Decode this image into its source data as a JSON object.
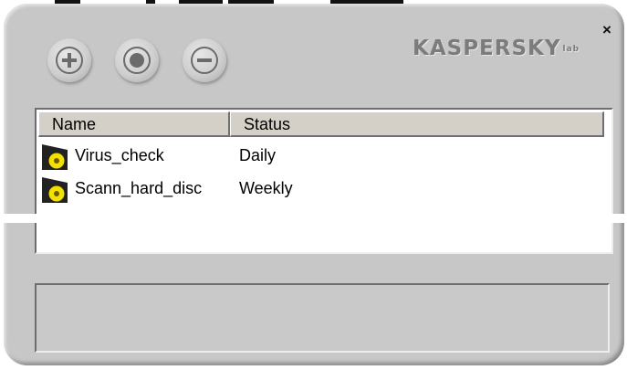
{
  "window": {
    "brand": "KASPERSKY",
    "brand_suffix": "lab",
    "close_label": "×"
  },
  "toolbar": {
    "add_icon": "plus-circle-icon",
    "start_icon": "record-circle-icon",
    "remove_icon": "minus-circle-icon"
  },
  "list": {
    "columns": [
      "Name",
      "Status"
    ],
    "rows": [
      {
        "name": "Virus_check",
        "status": "Daily",
        "icon": "task-icon"
      },
      {
        "name": "Scann_hard_disc",
        "status": "Weekly",
        "icon": "task-icon"
      }
    ]
  },
  "colors": {
    "window": "#c7c7c7",
    "logo": "#7c7c7c",
    "icon_yellow": "#f2e100"
  }
}
